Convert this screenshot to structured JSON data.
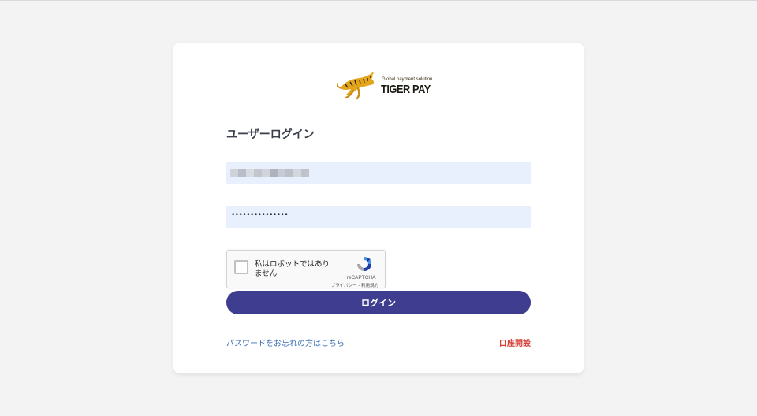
{
  "logo": {
    "tagline": "Global payment solution",
    "name": "TIGER PAY"
  },
  "login": {
    "title": "ユーザーログイン",
    "username_value": "",
    "password_dots": "•••••••••••••••",
    "button_label": "ログイン"
  },
  "recaptcha": {
    "label": "私はロボットではありません",
    "brand": "reCAPTCHA",
    "links": "プライバシー - 利用規約"
  },
  "links": {
    "forgot_password": "パスワードをお忘れの方はこちら",
    "open_account": "口座開設"
  },
  "colors": {
    "button": "#3e3d8f",
    "forgot_link": "#3a6fb6",
    "open_account": "#d43c32",
    "input_bg": "#e8f0fe"
  },
  "icons": {
    "logo": "tiger-icon",
    "captcha": "recaptcha-icon"
  }
}
